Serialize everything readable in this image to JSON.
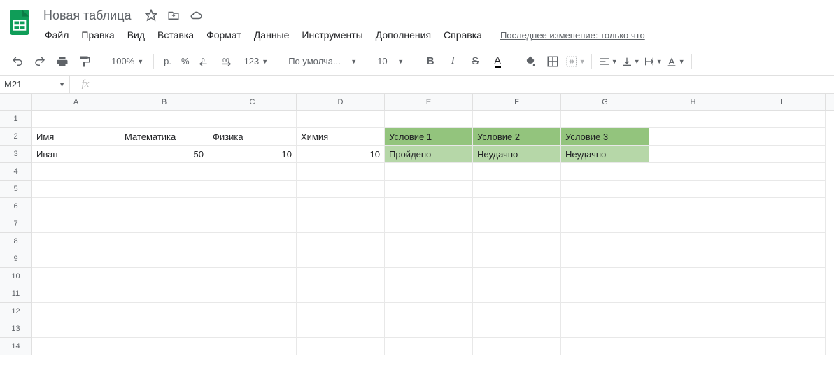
{
  "doc_title": "Новая таблица",
  "menus": [
    "Файл",
    "Правка",
    "Вид",
    "Вставка",
    "Формат",
    "Данные",
    "Инструменты",
    "Дополнения",
    "Справка"
  ],
  "last_edit": "Последнее изменение: только что",
  "toolbar": {
    "zoom": "100%",
    "currency": "р.",
    "percent": "%",
    "dec_dec": ".0",
    "inc_dec": ".00",
    "num_format": "123",
    "font": "По умолча...",
    "font_size": "10"
  },
  "name_box": "M21",
  "fx_label": "fx",
  "columns": [
    "A",
    "B",
    "C",
    "D",
    "E",
    "F",
    "G",
    "H",
    "I"
  ],
  "row_count": 14,
  "cells": {
    "r2": {
      "A": "Имя",
      "B": "Математика",
      "C": "Физика",
      "D": "Химия",
      "E": "Условие 1",
      "F": "Условие 2",
      "G": "Условие 3"
    },
    "r3": {
      "A": "Иван",
      "B": "50",
      "C": "10",
      "D": "10",
      "E": "Пройдено",
      "F": "Неудачно",
      "G": "Неудачно"
    }
  },
  "chart_data": {
    "type": "table",
    "headers": [
      "Имя",
      "Математика",
      "Физика",
      "Химия",
      "Условие 1",
      "Условие 2",
      "Условие 3"
    ],
    "rows": [
      [
        "Иван",
        50,
        10,
        10,
        "Пройдено",
        "Неудачно",
        "Неудачно"
      ]
    ],
    "highlight_columns": [
      "Условие 1",
      "Условие 2",
      "Условие 3"
    ],
    "highlight_colors": {
      "header": "#93c47d",
      "body": "#b6d7a8"
    }
  }
}
